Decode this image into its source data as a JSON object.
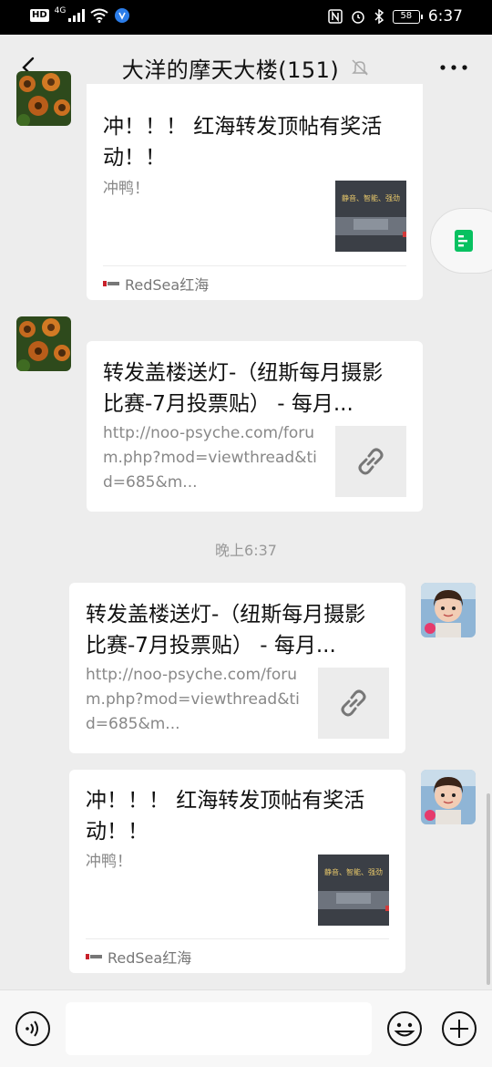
{
  "status_bar": {
    "hd": "HD",
    "network": "4G",
    "battery": "58",
    "time": "6:37"
  },
  "header": {
    "title": "大洋的摩天大楼(151)"
  },
  "messages": [
    {
      "sender": "left",
      "title": "冲！！！ 红海转发顶帖有奖活动！！",
      "desc": "冲鸭！",
      "thumb_text": "静音、智能、强劲",
      "source": "RedSea红海"
    },
    {
      "sender": "left",
      "title": "转发盖楼送灯-（纽斯每月摄影比赛-7月投票贴） - 每月...",
      "desc": "http://noo-psyche.com/forum.php?mod=viewthread&tid=685&m..."
    },
    {
      "time": "晚上6:37"
    },
    {
      "sender": "right",
      "title": "转发盖楼送灯-（纽斯每月摄影比赛-7月投票贴） - 每月...",
      "desc": "http://noo-psyche.com/forum.php?mod=viewthread&tid=685&m..."
    },
    {
      "sender": "right",
      "title": "冲！！！ 红海转发顶帖有奖活动！！",
      "desc": "冲鸭！",
      "thumb_text": "静音、智能、强劲",
      "source": "RedSea红海"
    }
  ],
  "input": {
    "value": ""
  },
  "colors": {
    "background": "#ededed",
    "bubble": "#ffffff",
    "float_tab_icon": "#07c160"
  }
}
